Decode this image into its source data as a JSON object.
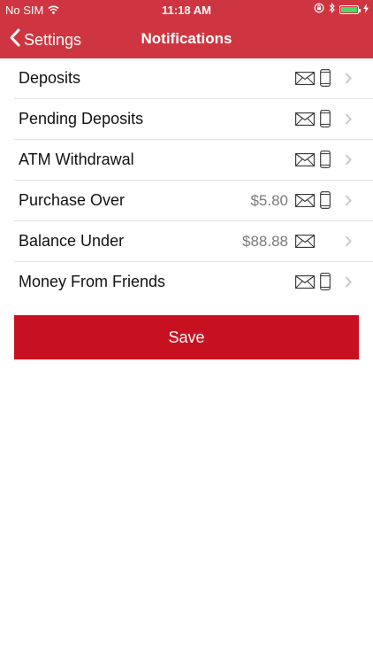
{
  "status_bar": {
    "carrier": "No SIM",
    "time": "11:18 AM",
    "battery_color": "#4cd964"
  },
  "nav": {
    "back_label": "Settings",
    "title": "Notifications"
  },
  "rows": [
    {
      "label": "Deposits",
      "amount": "",
      "icons": [
        "envelope-icon",
        "phone-icon"
      ]
    },
    {
      "label": "Pending Deposits",
      "amount": "",
      "icons": [
        "envelope-icon",
        "phone-icon"
      ]
    },
    {
      "label": "ATM Withdrawal",
      "amount": "",
      "icons": [
        "envelope-icon",
        "phone-icon"
      ]
    },
    {
      "label": "Purchase Over",
      "amount": "$5.80",
      "icons": [
        "envelope-icon",
        "phone-icon"
      ]
    },
    {
      "label": "Balance Under",
      "amount": "$88.88",
      "icons": [
        "envelope-icon"
      ]
    },
    {
      "label": "Money From Friends",
      "amount": "",
      "icons": [
        "envelope-icon",
        "phone-icon"
      ]
    }
  ],
  "save_label": "Save",
  "colors": {
    "nav_background": "#cf3540",
    "save_background": "#c81120"
  }
}
